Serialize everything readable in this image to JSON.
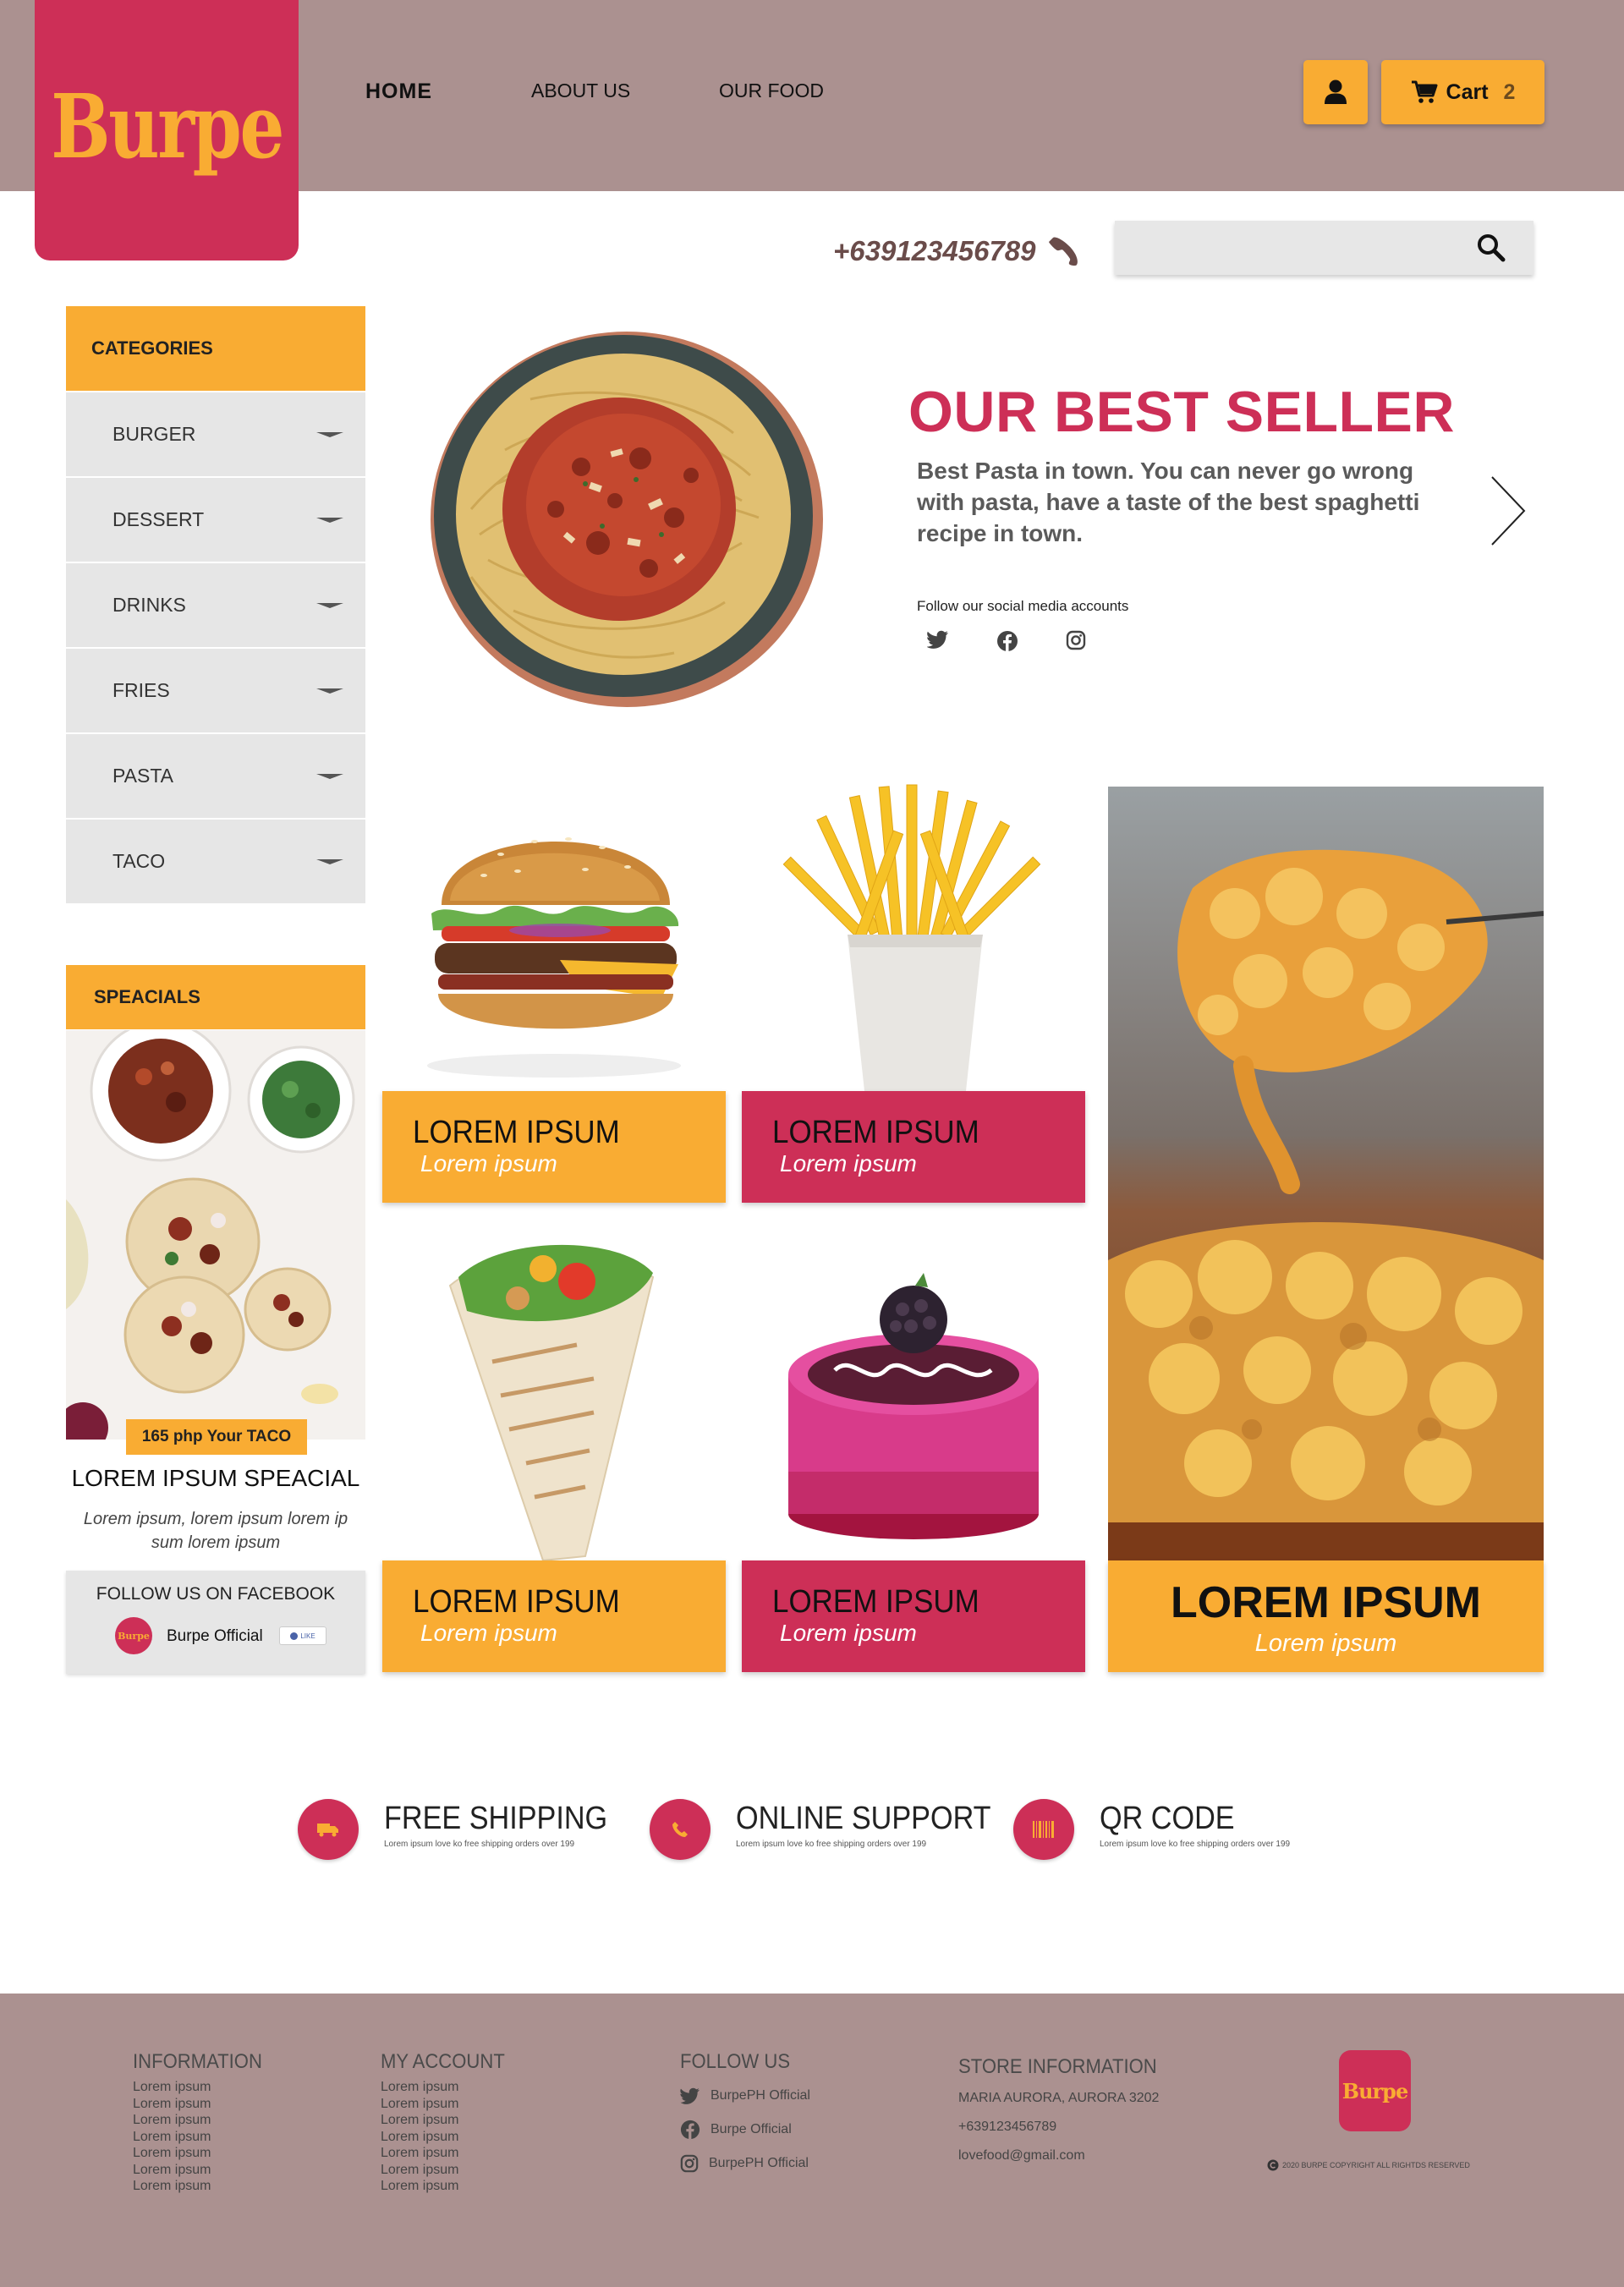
{
  "brand": {
    "name": "Burpe",
    "colors": {
      "primary": "#cd2f57",
      "accent": "#f9ac33",
      "header_bg": "#ab9190"
    }
  },
  "nav": {
    "home": "HOME",
    "about": "ABOUT US",
    "food": "OUR FOOD"
  },
  "header": {
    "user_icon": "user-icon",
    "cart_label": "Cart",
    "cart_count": "2",
    "phone": "+639123456789",
    "search_placeholder": ""
  },
  "categories": {
    "title": "CATEGORIES",
    "items": [
      {
        "label": "BURGER"
      },
      {
        "label": "DESSERT"
      },
      {
        "label": "DRINKS"
      },
      {
        "label": "FRIES"
      },
      {
        "label": "PASTA"
      },
      {
        "label": "TACO"
      }
    ]
  },
  "specials": {
    "title": "SPEACIALS",
    "price": "165 php  Your TACO",
    "item_title": "LOREM IPSUM SPEACIAL",
    "item_desc": "Lorem ipsum, lorem ipsum lorem ip sum lorem ipsum",
    "facebook": {
      "title": "FOLLOW US ON FACEBOOK",
      "page_name": "Burpe Official",
      "avatar_text": "Burpe",
      "like_label": "LIKE"
    }
  },
  "hero": {
    "title": "OUR BEST SELLER",
    "description": "Best Pasta in town. You can never go wrong with pasta, have a taste of the best spaghetti recipe in town.",
    "follow_label": "Follow our social media accounts"
  },
  "products": [
    {
      "title": "LOREM IPSUM",
      "subtitle": "Lorem ipsum",
      "image": "burger"
    },
    {
      "title": "LOREM IPSUM",
      "subtitle": "Lorem ipsum",
      "image": "fries"
    },
    {
      "title": "LOREM IPSUM",
      "subtitle": "Lorem ipsum",
      "image": "wrap"
    },
    {
      "title": "LOREM IPSUM",
      "subtitle": "Lorem ipsum",
      "image": "cake"
    },
    {
      "title": "LOREM IPSUM",
      "subtitle": "Lorem ipsum",
      "image": "mac-and-cheese"
    }
  ],
  "features": [
    {
      "title": "FREE SHIPPING",
      "sub": "Lorem ipsum love ko free shipping orders over 199",
      "icon": "truck-icon"
    },
    {
      "title": "ONLINE SUPPORT",
      "sub": "Lorem ipsum love ko free shipping orders over 199",
      "icon": "phone-icon"
    },
    {
      "title": "QR CODE",
      "sub": "Lorem ipsum love ko free shipping orders over 199",
      "icon": "barcode-icon"
    }
  ],
  "footer": {
    "information": {
      "title": "INFORMATION",
      "items": [
        "Lorem ipsum",
        "Lorem ipsum",
        "Lorem ipsum",
        "Lorem ipsum",
        "Lorem ipsum",
        "Lorem ipsum",
        "Lorem ipsum"
      ]
    },
    "account": {
      "title": "MY ACCOUNT",
      "items": [
        "Lorem ipsum",
        "Lorem ipsum",
        "Lorem ipsum",
        "Lorem ipsum",
        "Lorem ipsum",
        "Lorem ipsum",
        "Lorem ipsum"
      ]
    },
    "follow": {
      "title": "FOLLOW US",
      "twitter": "BurpePH Official",
      "facebook": "Burpe Official",
      "instagram": "BurpePH Official"
    },
    "store": {
      "title": "STORE INFORMATION",
      "address": "MARIA AURORA, AURORA 3202",
      "phone": "+639123456789",
      "email": "lovefood@gmail.com"
    },
    "logo": "Burpe",
    "copyright": "2020 BURPE COPYRIGHT ALL RIGHTDS RESERVED"
  }
}
